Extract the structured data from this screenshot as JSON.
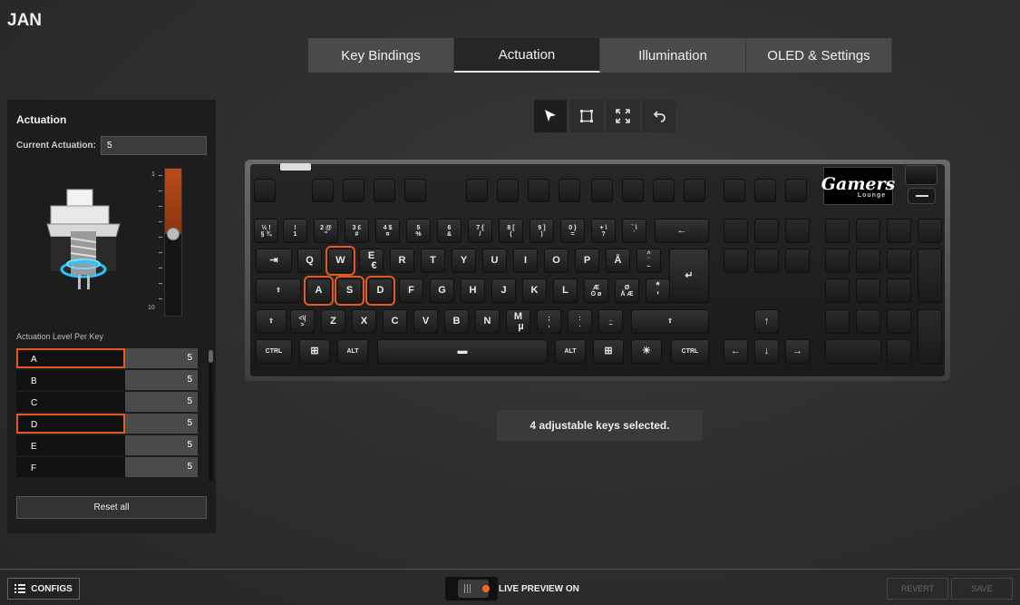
{
  "profile_name": "JAN",
  "tabs": [
    {
      "label": "Key Bindings",
      "active": false
    },
    {
      "label": "Actuation",
      "active": true
    },
    {
      "label": "Illumination",
      "active": false
    },
    {
      "label": "OLED & Settings",
      "active": false
    }
  ],
  "actuation_panel": {
    "title": "Actuation",
    "current_label": "Current Actuation:",
    "current_value": "5",
    "slider": {
      "min_label": "1",
      "max_label": "10",
      "value": 5,
      "min": 1,
      "max": 10
    },
    "per_key_label": "Actuation Level Per Key",
    "keys": [
      {
        "key": "A",
        "value": "5",
        "selected": true
      },
      {
        "key": "B",
        "value": "5",
        "selected": false
      },
      {
        "key": "C",
        "value": "5",
        "selected": false
      },
      {
        "key": "D",
        "value": "5",
        "selected": true
      },
      {
        "key": "E",
        "value": "5",
        "selected": false
      },
      {
        "key": "F",
        "value": "5",
        "selected": false
      }
    ],
    "reset_label": "Reset all"
  },
  "toolbar": [
    "select-icon",
    "rectangle-select-icon",
    "fullscreen-icon",
    "undo-icon"
  ],
  "oled_logo": {
    "text": "Gamers",
    "sub": "Lounge"
  },
  "status_message": "4 adjustable keys selected.",
  "footer": {
    "configs_label": "CONFIGS",
    "live_preview_label": "LIVE PREVIEW ON",
    "revert_label": "REVERT",
    "save_label": "SAVE"
  },
  "colors": {
    "accent": "#e25a1f",
    "live_dot": "#f26a1b"
  }
}
